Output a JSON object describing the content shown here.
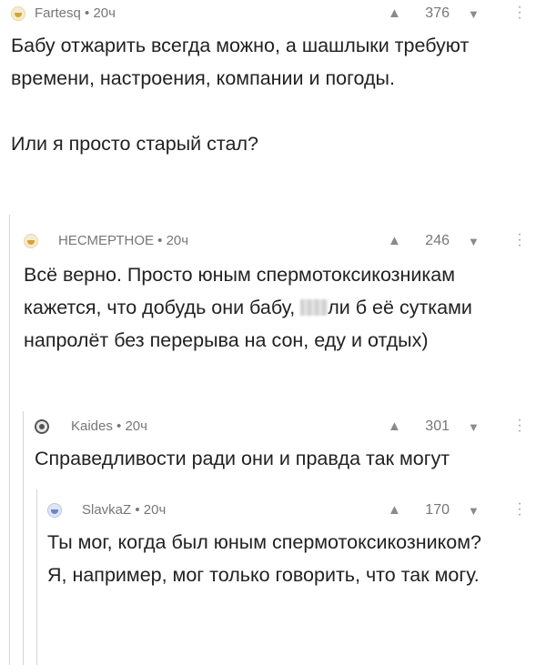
{
  "comments": [
    {
      "author": "Fartesq",
      "time": "20ч",
      "score": "376",
      "text": "Бабу отжарить всегда можно, а шашлыки требуют времени, настроения, компании и погоды.\n\nИли я просто старый стал?"
    },
    {
      "author": "НЕСМЕРТНОЕ",
      "time": "20ч",
      "score": "246",
      "text_before": "Всё верно. Просто юным спермотоксикозникам кажется, что добудь они бабу, ",
      "text_after": "ли б её сутками напролёт без перерыва на сон, еду и отдых)"
    },
    {
      "author": "Kaides",
      "time": "20ч",
      "score": "301",
      "text": "Справедливости ради они и правда так могут"
    },
    {
      "author": "SlavkaZ",
      "time": "20ч",
      "score": "170",
      "text": "Ты мог, когда был юным спермотоксикозником? Я, например, мог только говорить, что так могу."
    }
  ],
  "separator": " • ",
  "icons": {
    "upvote": "upvote-triangle-icon",
    "downvote": "downvote-triangle-icon",
    "more": "more-vertical-icon"
  }
}
